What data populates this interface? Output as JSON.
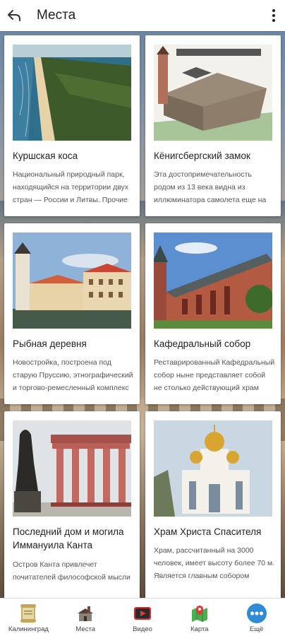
{
  "header": {
    "title": "Места"
  },
  "places": [
    {
      "name": "Куршская коса",
      "desc": "Национальный природный парк, находящийся на территории двух стран — России и Литвы. Прочие"
    },
    {
      "name": "Кёнигсбергский замок",
      "desc": "Эта достопримечательность родом из 13 века видна из иллюминатора самолета еще на подлете к городу"
    },
    {
      "name": "Рыбная деревня",
      "desc": "Новостройка, построена под старую Пруссию, этнографический и торгово-ремесленный комплекс"
    },
    {
      "name": "Кафедральный собор",
      "desc": "Реставрированный Кафедральный собор ныне представляет собой не столько действующий храм"
    },
    {
      "name": "Последний дом и могила Иммануила Канта",
      "desc": "Остров Канта привлечет почитателей философской мысли"
    },
    {
      "name": "Храм Христа Спасителя",
      "desc": "Храм, рассчитанный на 3000 человек, имеет высоту более 70 м. Является главным собором"
    }
  ],
  "nav": [
    {
      "label": "Калининград",
      "icon": "scroll-icon"
    },
    {
      "label": "Места",
      "icon": "church-icon"
    },
    {
      "label": "Видео",
      "icon": "video-icon"
    },
    {
      "label": "Карта",
      "icon": "map-icon"
    },
    {
      "label": "Ещё",
      "icon": "more-icon"
    }
  ]
}
